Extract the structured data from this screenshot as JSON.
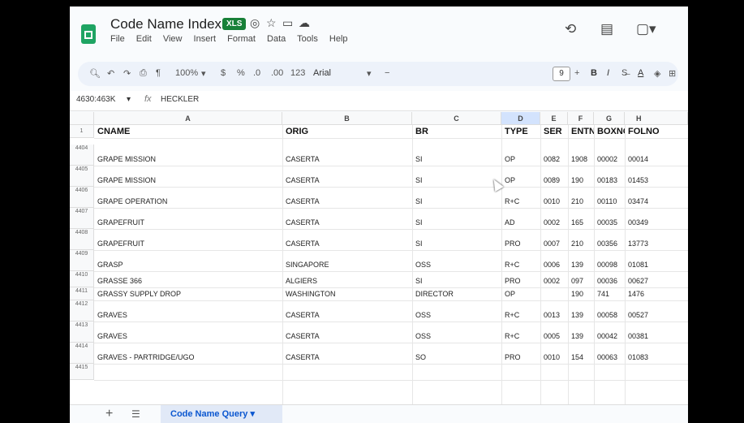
{
  "title": {
    "doc": "Code Name Index",
    "badge": "XLS"
  },
  "menu": [
    "File",
    "Edit",
    "View",
    "Insert",
    "Format",
    "Data",
    "Tools",
    "Help"
  ],
  "toolbar": {
    "zoom": "100%",
    "currency": "$",
    "percent": "%",
    "dec_dec": ".0",
    "dec_inc": ".00",
    "num_fmt": "123",
    "font": "Arial",
    "font_size": "9",
    "bold": "B",
    "italic": "I",
    "underline": "A"
  },
  "formula_bar": {
    "name_box": "4630:463K",
    "fx": "fx",
    "value": "HECKLER"
  },
  "columns": [
    "A",
    "B",
    "C",
    "D",
    "E",
    "F",
    "G",
    "H"
  ],
  "header_row": {
    "num": "1",
    "cells": [
      "CNAME",
      "ORIG",
      "BR",
      "TYPE",
      "SER",
      "ENTNO",
      "BOXNO",
      "FOLNO"
    ]
  },
  "rows": [
    {
      "num": "4404",
      "cells": [
        "GRAPE MISSION",
        "CASERTA",
        "SI",
        "OP",
        "0082",
        "1908",
        "00002",
        "00014"
      ]
    },
    {
      "num": "4405",
      "cells": [
        "GRAPE MISSION",
        "CASERTA",
        "SI",
        "OP",
        "0089",
        "190",
        "00183",
        "01453"
      ]
    },
    {
      "num": "4406",
      "cells": [
        "GRAPE OPERATION",
        "CASERTA",
        "SI",
        "R+C",
        "0010",
        "210",
        "00110",
        "03474"
      ]
    },
    {
      "num": "4407",
      "cells": [
        "GRAPEFRUIT",
        "CASERTA",
        "SI",
        "AD",
        "0002",
        "165",
        "00035",
        "00349"
      ]
    },
    {
      "num": "4408",
      "cells": [
        "GRAPEFRUIT",
        "CASERTA",
        "SI",
        "PRO",
        "0007",
        "210",
        "00356",
        "13773"
      ]
    },
    {
      "num": "4409",
      "cells": [
        "GRASP",
        "SINGAPORE",
        "OSS",
        "R+C",
        "0006",
        "139",
        "00098",
        "01081"
      ]
    },
    {
      "num": "4410",
      "cells": [
        "GRASSE 366",
        "ALGIERS",
        "SI",
        "PRO",
        "0002",
        "097",
        "00036",
        "00627"
      ]
    },
    {
      "num": "4411",
      "cells": [
        "GRASSY SUPPLY DROP",
        "WASHINGTON",
        "DIRECTOR",
        "OP",
        "",
        "190",
        "741",
        "1476"
      ]
    },
    {
      "num": "4412",
      "cells": [
        "GRAVES",
        "CASERTA",
        "OSS",
        "R+C",
        "0013",
        "139",
        "00058",
        "00527"
      ]
    },
    {
      "num": "4413",
      "cells": [
        "GRAVES",
        "CASERTA",
        "OSS",
        "R+C",
        "0005",
        "139",
        "00042",
        "00381"
      ]
    },
    {
      "num": "4414",
      "cells": [
        "GRAVES - PARTRIDGE/UGO",
        "CASERTA",
        "SO",
        "PRO",
        "0010",
        "154",
        "00063",
        "01083"
      ]
    },
    {
      "num": "4415",
      "cells": [
        "",
        "",
        "",
        "",
        "",
        "",
        "",
        ""
      ]
    }
  ],
  "sheet_tab": "Code Name Query"
}
